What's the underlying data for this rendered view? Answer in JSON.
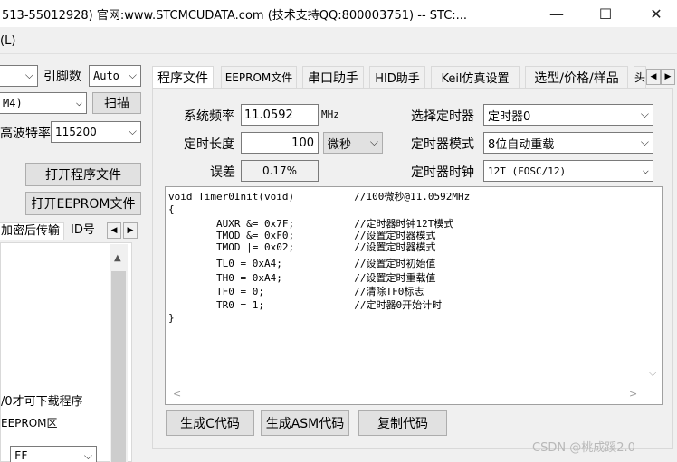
{
  "window": {
    "title": "513-55012928) 官网:www.STCMCUDATA.com  (技术支持QQ:800003751) -- STC:...",
    "minimize_glyph": "—",
    "maximize_glyph": "☐",
    "close_glyph": "✕"
  },
  "menubar": {
    "item": "(L)"
  },
  "left": {
    "baud_label": "引脚数",
    "pin_combo_value": "Auto",
    "port_combo_value": "M4)",
    "scan_button": "扫描",
    "baud_rate_label": "高波特率",
    "baud_value": "115200",
    "open_program_button": "打开程序文件",
    "open_eeprom_button": "打开EEPROM文件",
    "tab1": "加密后传输",
    "tab2": "ID号",
    "note1": "/0才可下载程序",
    "note2": "EEPROM区",
    "bottom_combo_value": "FF"
  },
  "tabs": [
    {
      "label": "程序文件"
    },
    {
      "label": "EEPROM文件"
    },
    {
      "label": "串口助手"
    },
    {
      "label": "HID助手"
    },
    {
      "label": "Keil仿真设置"
    },
    {
      "label": "选型/价格/样品"
    },
    {
      "label": "头"
    }
  ],
  "timer": {
    "sysclk_label": "系统频率",
    "sysclk_value": "11.0592",
    "sysclk_unit": "MHz",
    "select_timer_label": "选择定时器",
    "select_timer_value": "定时器0",
    "length_label": "定时长度",
    "length_value": "100",
    "length_unit": "微秒",
    "mode_label": "定时器模式",
    "mode_value": "8位自动重载",
    "error_label": "误差",
    "error_value": "0.17%",
    "clock_label": "定时器时钟",
    "clock_value": "12T (FOSC/12)"
  },
  "code": [
    "void Timer0Init(void)          //100微秒@11.0592MHz",
    "{",
    "        AUXR &= 0x7F;          //定时器时钟12T模式",
    "        TMOD &= 0xF0;          //设置定时器模式",
    "        TMOD |= 0x02;          //设置定时器模式",
    "        TL0 = 0xA4;            //设置定时初始值",
    "        TH0 = 0xA4;            //设置定时重载值",
    "        TF0 = 0;               //清除TF0标志",
    "        TR0 = 1;               //定时器0开始计时",
    "}"
  ],
  "buttons": {
    "gen_c": "生成C代码",
    "gen_asm": "生成ASM代码",
    "copy": "复制代码"
  },
  "watermark": "CSDN @桃成蹊2.0"
}
